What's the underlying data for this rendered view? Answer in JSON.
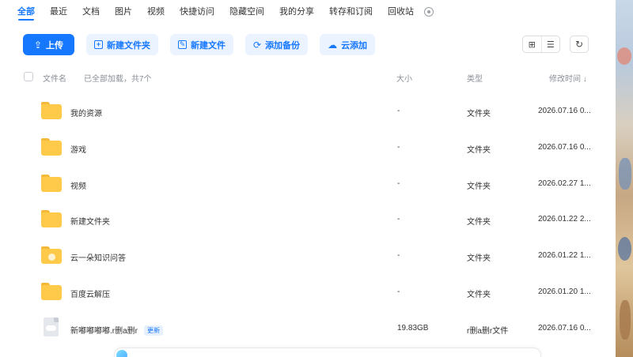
{
  "tabs": [
    {
      "label": "全部",
      "active": true
    },
    {
      "label": "最近"
    },
    {
      "label": "文档"
    },
    {
      "label": "图片"
    },
    {
      "label": "视频"
    },
    {
      "label": "快捷访问"
    },
    {
      "label": "隐藏空间"
    },
    {
      "label": "我的分享"
    },
    {
      "label": "转存和订阅"
    },
    {
      "label": "回收站"
    }
  ],
  "toolbar": {
    "upload": "上传",
    "new_folder": "新建文件夹",
    "new_file": "新建文件",
    "add_backup": "添加备份",
    "cloud_add": "云添加"
  },
  "header": {
    "name": "文件名",
    "loaded": "已全部加载，共7个",
    "size": "大小",
    "type": "类型",
    "mtime": "修改时间"
  },
  "sort_indicator": "↓",
  "files": [
    {
      "name": "我的资源",
      "size": "-",
      "type": "文件夹",
      "mtime": "2026.07.16 0...",
      "icon": "folder-icon"
    },
    {
      "name": "游戏",
      "size": "-",
      "type": "文件夹",
      "mtime": "2026.07.16 0...",
      "icon": "folder-icon"
    },
    {
      "name": "视频",
      "size": "-",
      "type": "文件夹",
      "mtime": "2026.02.27 1...",
      "icon": "folder-icon"
    },
    {
      "name": "新建文件夹",
      "size": "-",
      "type": "文件夹",
      "mtime": "2026.01.22 2...",
      "icon": "folder-icon"
    },
    {
      "name": "云一朵知识问答",
      "size": "-",
      "type": "文件夹",
      "mtime": "2026.01.22 1...",
      "icon": "folder-badge-icon"
    },
    {
      "name": "百度云解压",
      "size": "-",
      "type": "文件夹",
      "mtime": "2026.01.20 1...",
      "icon": "folder-icon"
    },
    {
      "name": "新嘟嘟嘟嘟.r删a删r",
      "tag": "更新",
      "size": "19.83GB",
      "type": "r删a删r文件",
      "mtime": "2026.07.16 0...",
      "icon": "file-icon"
    }
  ],
  "colors": {
    "accent": "#1677ff",
    "accent_light": "#eaf3ff",
    "folder": "#ffc94a"
  }
}
